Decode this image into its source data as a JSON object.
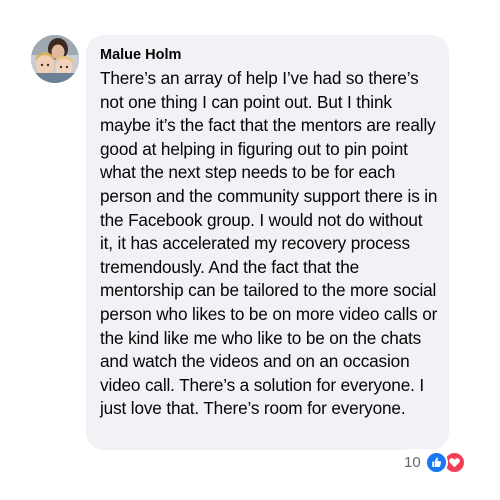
{
  "comment": {
    "author": "Malue Holm",
    "text": "There’s an array of help I’ve had so there’s not one thing I can point out. But I think maybe it’s the fact that the mentors are really good at helping in figuring out to pin point what the next step needs to be for each person and the community support there is in the Facebook group. I would not do without it, it has accelerated my recovery process tremendously. And the fact that the mentorship can be tailored to the more social person who likes to be on more video calls or the kind like me who like to be on the chats and watch the videos and on an occasion video call. There’s a solution for everyone. I just love that. There’s room for everyone."
  },
  "reactions": {
    "count": "10",
    "icons": [
      "like-icon",
      "love-icon"
    ],
    "colors": {
      "like": "#1877f2",
      "love": "#f33e58"
    }
  },
  "colors": {
    "bubble": "#f0f2f5",
    "text": "#050505",
    "count": "#65676b"
  }
}
